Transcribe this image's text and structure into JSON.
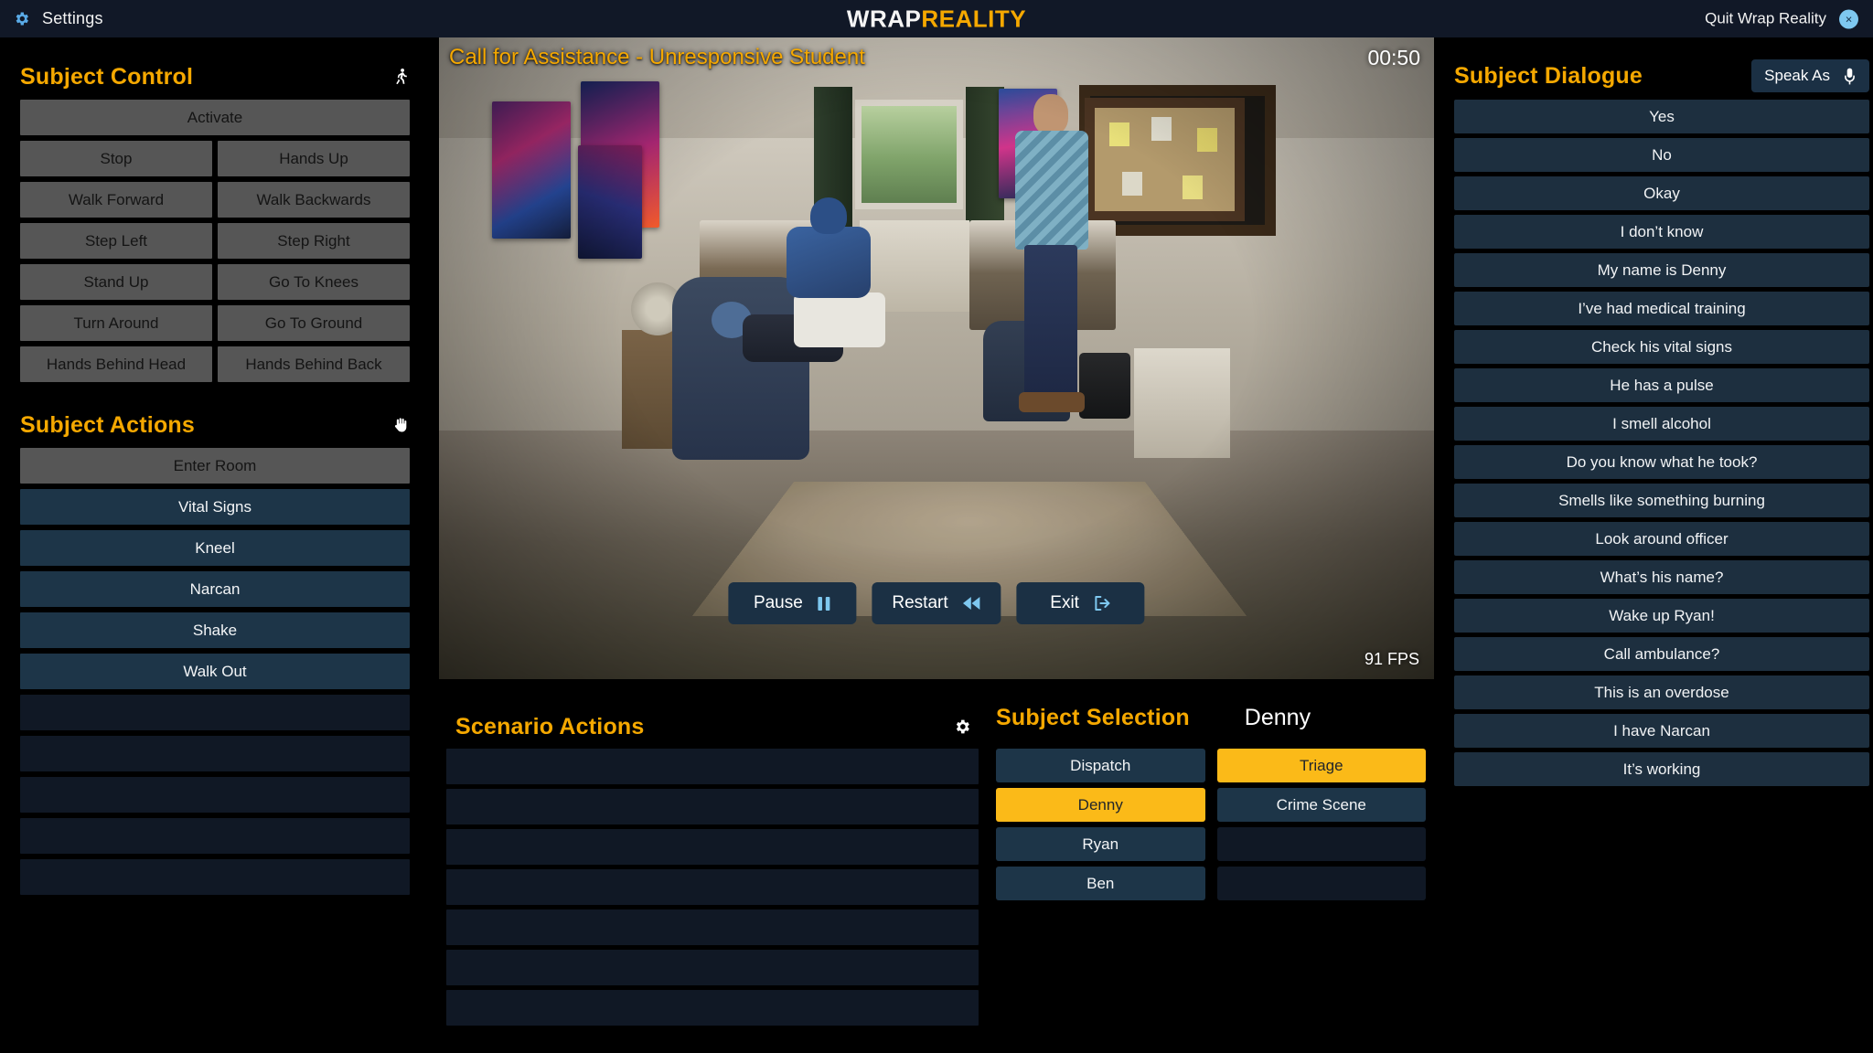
{
  "topbar": {
    "settings_label": "Settings",
    "brand_first": "WRAP",
    "brand_second": "REALITY",
    "quit_label": "Quit Wrap Reality",
    "close_glyph": "×",
    "accent_orange": "#f5a800",
    "accent_blue": "#7ec8f0"
  },
  "subject_control": {
    "title": "Subject Control",
    "icon": "running-person-icon",
    "activate_label": "Activate",
    "rows": [
      [
        "Stop",
        "Hands Up"
      ],
      [
        "Walk Forward",
        "Walk Backwards"
      ],
      [
        "Step Left",
        "Step Right"
      ],
      [
        "Stand Up",
        "Go To Knees"
      ],
      [
        "Turn Around",
        "Go To Ground"
      ],
      [
        "Hands Behind Head",
        "Hands Behind Back"
      ]
    ]
  },
  "subject_actions": {
    "title": "Subject Actions",
    "icon": "hand-icon",
    "items": [
      {
        "label": "Enter Room",
        "style": "gray"
      },
      {
        "label": "Vital Signs",
        "style": "blue"
      },
      {
        "label": "Kneel",
        "style": "blue"
      },
      {
        "label": "Narcan",
        "style": "blue"
      },
      {
        "label": "Shake",
        "style": "blue"
      },
      {
        "label": "Walk Out",
        "style": "blue"
      }
    ],
    "empty_slots": 5
  },
  "video": {
    "title": "Call for Assistance - Unresponsive Student",
    "timer": "00:50",
    "fps": "91 FPS",
    "controls": [
      {
        "label": "Pause",
        "icon": "pause-icon"
      },
      {
        "label": "Restart",
        "icon": "rewind-icon"
      },
      {
        "label": "Exit",
        "icon": "exit-icon"
      }
    ]
  },
  "scenario_actions": {
    "title": "Scenario Actions",
    "icon": "gear-icon",
    "empty_slots": 7
  },
  "subject_selection": {
    "title": "Subject Selection",
    "active_subject": "Denny",
    "column_left": [
      {
        "label": "Dispatch",
        "selected": false
      },
      {
        "label": "Denny",
        "selected": true
      },
      {
        "label": "Ryan",
        "selected": false
      },
      {
        "label": "Ben",
        "selected": false
      }
    ],
    "column_right": [
      {
        "label": "Triage",
        "selected": true
      },
      {
        "label": "Crime Scene",
        "selected": false
      }
    ],
    "right_empty_slots": 2,
    "selected_color": "#fbba18"
  },
  "subject_dialogue": {
    "title": "Subject Dialogue",
    "speak_as_label": "Speak As",
    "speak_as_icon": "microphone-icon",
    "lines": [
      "Yes",
      "No",
      "Okay",
      "I don’t know",
      "My name is Denny",
      "I’ve had medical training",
      "Check his vital signs",
      "He has a pulse",
      "I smell alcohol",
      "Do you know what he took?",
      "Smells like something burning",
      "Look around officer",
      "What’s his name?",
      "Wake up Ryan!",
      "Call ambulance?",
      "This is an overdose",
      "I have Narcan",
      "It’s working"
    ]
  }
}
